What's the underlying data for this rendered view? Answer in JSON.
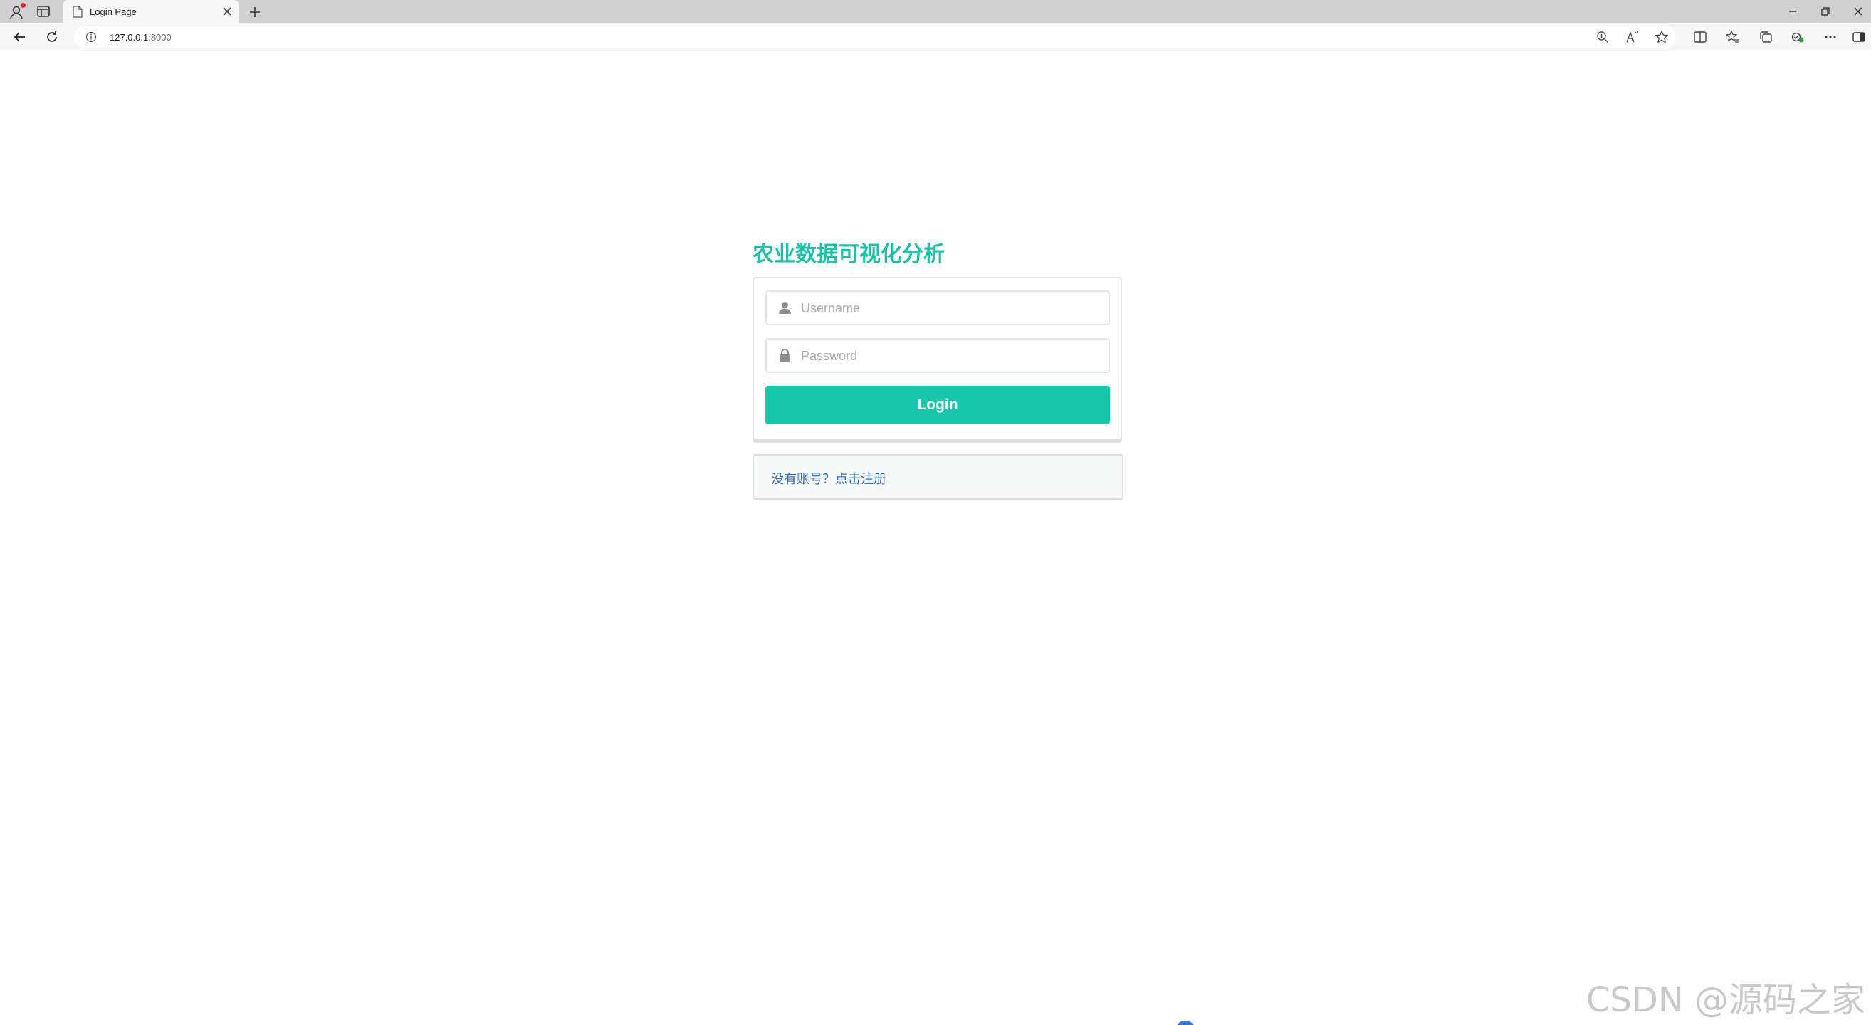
{
  "browser": {
    "tab": {
      "title": "Login Page"
    },
    "address_bar": {
      "host": "127.0.0.1",
      "port": ":8000"
    },
    "icons": {
      "profile": "profile-icon",
      "tab_actions": "tab-actions-icon",
      "new_tab": "plus-icon",
      "back": "back-arrow-icon",
      "refresh": "refresh-icon",
      "site_info": "info-icon",
      "zoom": "zoom-icon",
      "read_aloud": "read-aloud-icon",
      "favorite": "star-icon",
      "split_screen": "split-screen-icon",
      "favorites": "favorites-icon",
      "collections": "collections-icon",
      "extensions": "extension-icon",
      "more": "more-icon",
      "sidebar": "sidebar-icon"
    }
  },
  "page": {
    "app_title": "农业数据可视化分析",
    "username": {
      "placeholder": "Username",
      "value": ""
    },
    "password": {
      "placeholder": "Password",
      "value": ""
    },
    "login_label": "Login",
    "register_link": "没有账号？点击注册",
    "colors": {
      "accent": "#16c8a9",
      "title": "#1dc2a6",
      "link": "#2f6faf"
    }
  },
  "watermark": "CSDN @源码之家"
}
